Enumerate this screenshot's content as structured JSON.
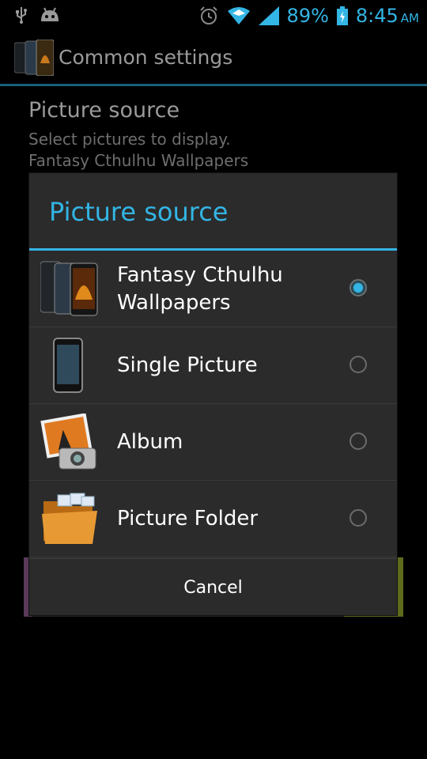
{
  "statusbar": {
    "battery_percent": "89%",
    "time": "8:45",
    "ampm": "AM"
  },
  "actionbar": {
    "title": "Common settings"
  },
  "background_pref": {
    "title": "Picture source",
    "summary_line1": "Select pictures to display.",
    "summary_line2": "Fantasy Cthulhu Wallpapers"
  },
  "dialog": {
    "title": "Picture source",
    "options": [
      {
        "label_line1": "Fantasy Cthulhu",
        "label_line2": "Wallpapers",
        "selected": true,
        "icon": "wallpaper-phones-icon"
      },
      {
        "label": "Single Picture",
        "selected": false,
        "icon": "phone-icon"
      },
      {
        "label": "Album",
        "selected": false,
        "icon": "photo-album-icon"
      },
      {
        "label": "Picture Folder",
        "selected": false,
        "icon": "folder-icon"
      }
    ],
    "cancel_label": "Cancel"
  },
  "colors": {
    "accent": "#33b5e5",
    "dialog_bg": "#2b2b2b"
  }
}
